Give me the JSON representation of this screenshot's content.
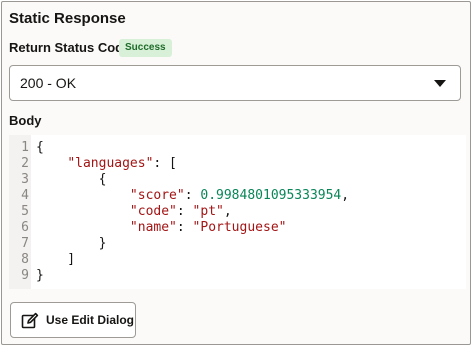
{
  "section": {
    "title": "Static Response"
  },
  "status": {
    "label": "Return Status Code",
    "badge": "Success",
    "selected": "200 - OK"
  },
  "body": {
    "label": "Body",
    "lines": [
      {
        "num": "1",
        "text": "{"
      },
      {
        "num": "2",
        "text": "    \"languages\": ["
      },
      {
        "num": "3",
        "text": "        {"
      },
      {
        "num": "4",
        "text": "            \"score\": 0.9984801095333954,"
      },
      {
        "num": "5",
        "text": "            \"code\": \"pt\","
      },
      {
        "num": "6",
        "text": "            \"name\": \"Portuguese\""
      },
      {
        "num": "7",
        "text": "        }"
      },
      {
        "num": "8",
        "text": "    ]"
      },
      {
        "num": "9",
        "text": "}"
      }
    ]
  },
  "actions": {
    "edit_dialog_label": "Use Edit Dialog",
    "edit_icon": "edit-icon"
  },
  "colors": {
    "badge_bg": "#d7f0d7",
    "badge_text": "#1f6b2a",
    "json_key": "#a31515",
    "json_number": "#098658"
  }
}
